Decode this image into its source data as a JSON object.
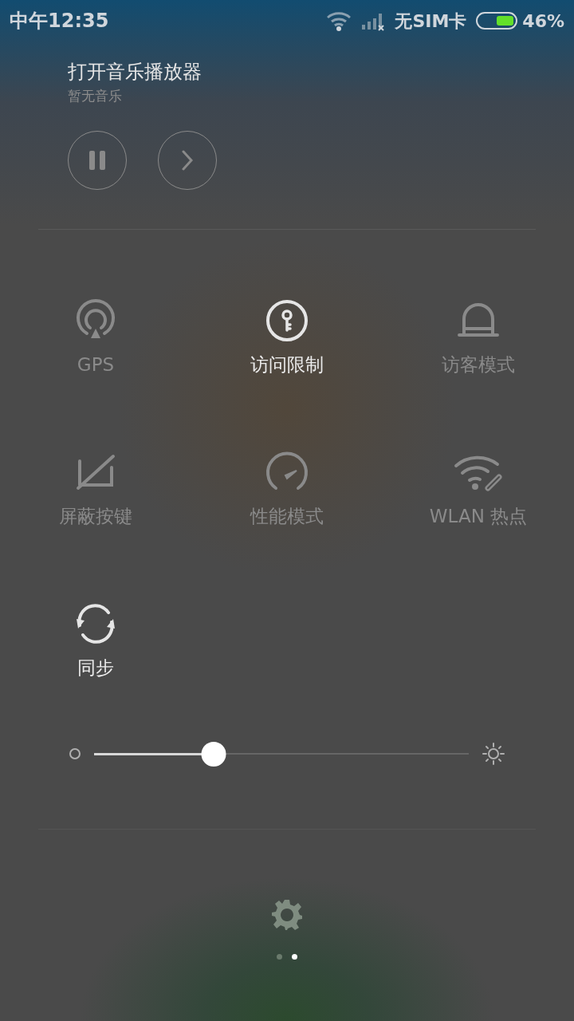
{
  "status_bar": {
    "time": "中午12:35",
    "carrier": "无SIM卡",
    "battery": "46%"
  },
  "music": {
    "title": "打开音乐播放器",
    "subtitle": "暂无音乐",
    "playing": true
  },
  "toggles": [
    {
      "kind": "gps",
      "label": "GPS",
      "on": false
    },
    {
      "kind": "key",
      "label": "访问限制",
      "on": true
    },
    {
      "kind": "guest",
      "label": "访客模式",
      "on": false
    },
    {
      "kind": "keys",
      "label": "屏蔽按键",
      "on": false
    },
    {
      "kind": "speed",
      "label": "性能模式",
      "on": false
    },
    {
      "kind": "hotspot",
      "label": "WLAN 热点",
      "on": false
    },
    {
      "kind": "sync",
      "label": "同步",
      "on": true
    }
  ],
  "brightness": {
    "level": 0.32
  },
  "pages": [
    {
      "selected": false
    },
    {
      "selected": true
    }
  ]
}
